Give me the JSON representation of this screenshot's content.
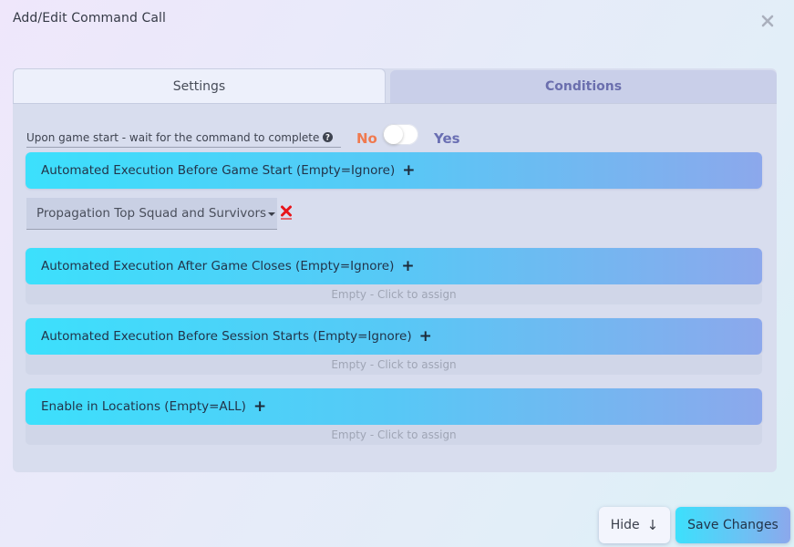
{
  "dialog": {
    "title": "Add/Edit Command Call"
  },
  "tabs": [
    {
      "label": "Settings",
      "active": true
    },
    {
      "label": "Conditions",
      "active": false
    }
  ],
  "wait_option": {
    "label": "Upon game start - wait for the command to complete",
    "no_label": "No",
    "yes_label": "Yes",
    "value": false
  },
  "sections": [
    {
      "label": "Automated Execution Before Game Start (Empty=Ignore)",
      "items": [
        {
          "label": "Propagation Top Squad and Survivors"
        }
      ]
    },
    {
      "label": "Automated Execution After Game Closes (Empty=Ignore)",
      "empty_text": "Empty - Click to assign"
    },
    {
      "label": "Automated Execution Before Session Starts (Empty=Ignore)",
      "empty_text": "Empty - Click to assign"
    },
    {
      "label": "Enable in Locations (Empty=ALL)",
      "empty_text": "Empty - Click to assign"
    }
  ],
  "buttons": {
    "hide_label": "Hide",
    "hide_arrow": "↓",
    "save_label": "Save Changes"
  },
  "colors": {
    "no_color": "#f07a4f",
    "yes_color": "#6a6fb3",
    "header_gradient_start": "#3ce0fc",
    "header_gradient_end": "#8ca8ec",
    "remove_icon": "#e8141a"
  },
  "icons": {
    "close": "close-icon",
    "help": "help-icon",
    "add": "plus-icon",
    "remove": "remove-x-icon",
    "dropdown": "caret-down-icon"
  }
}
